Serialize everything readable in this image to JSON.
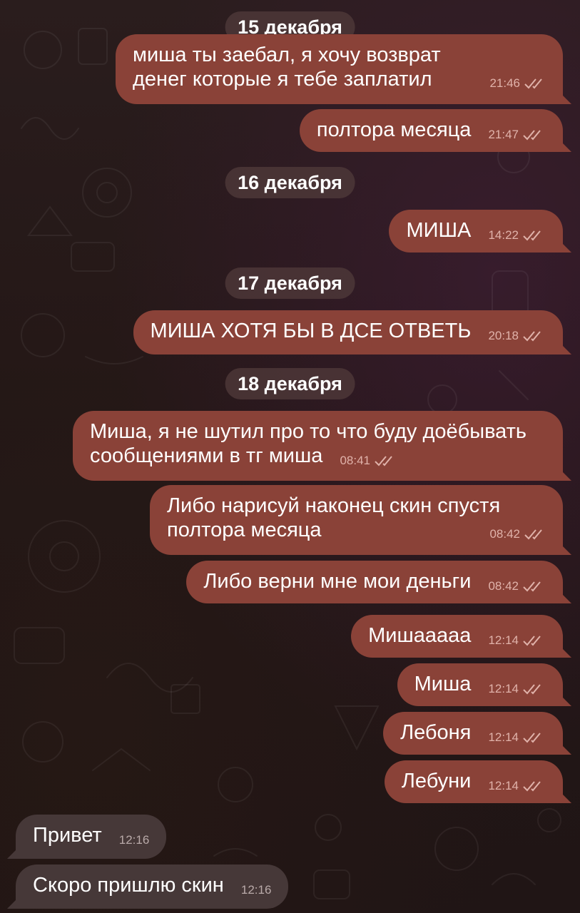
{
  "theme": {
    "bubble_out": "#8a4238",
    "bubble_in": "#463838",
    "text": "#ffffff",
    "meta": "#e0b2aa"
  },
  "dates": [
    "15 декабря",
    "16 декабря",
    "17 декабря",
    "18 декабря"
  ],
  "messages": [
    {
      "text": "миша ты заебал, я хочу возврат денег которые я тебе заплатил",
      "time": "21:46",
      "status": "read-double-check"
    },
    {
      "text": "полтора месяца",
      "time": "21:47",
      "status": "read-double-check"
    },
    {
      "text": "МИША",
      "time": "14:22",
      "status": "read-double-check"
    },
    {
      "text": "МИША ХОТЯ БЫ В ДСЕ ОТВЕТЬ",
      "time": "20:18",
      "status": "read-double-check"
    },
    {
      "text": "Миша, я не шутил про то что буду доёбывать сообщениями в тг миша",
      "time": "08:41",
      "status": "read-double-check"
    },
    {
      "text": "Либо нарисуй наконец скин спустя полтора месяца",
      "time": "08:42",
      "status": "read-double-check"
    },
    {
      "text": "Либо верни мне мои деньги",
      "time": "08:42",
      "status": "read-double-check"
    },
    {
      "text": "Мишааааа",
      "time": "12:14",
      "status": "read-double-check"
    },
    {
      "text": "Миша",
      "time": "12:14",
      "status": "read-double-check"
    },
    {
      "text": "Лебоня",
      "time": "12:14",
      "status": "read-double-check"
    },
    {
      "text": "Лебуни",
      "time": "12:14",
      "status": "read-double-check"
    },
    {
      "text": "Привет",
      "time": "12:16"
    },
    {
      "text": "Скоро пришлю скин",
      "time": "12:16"
    }
  ]
}
